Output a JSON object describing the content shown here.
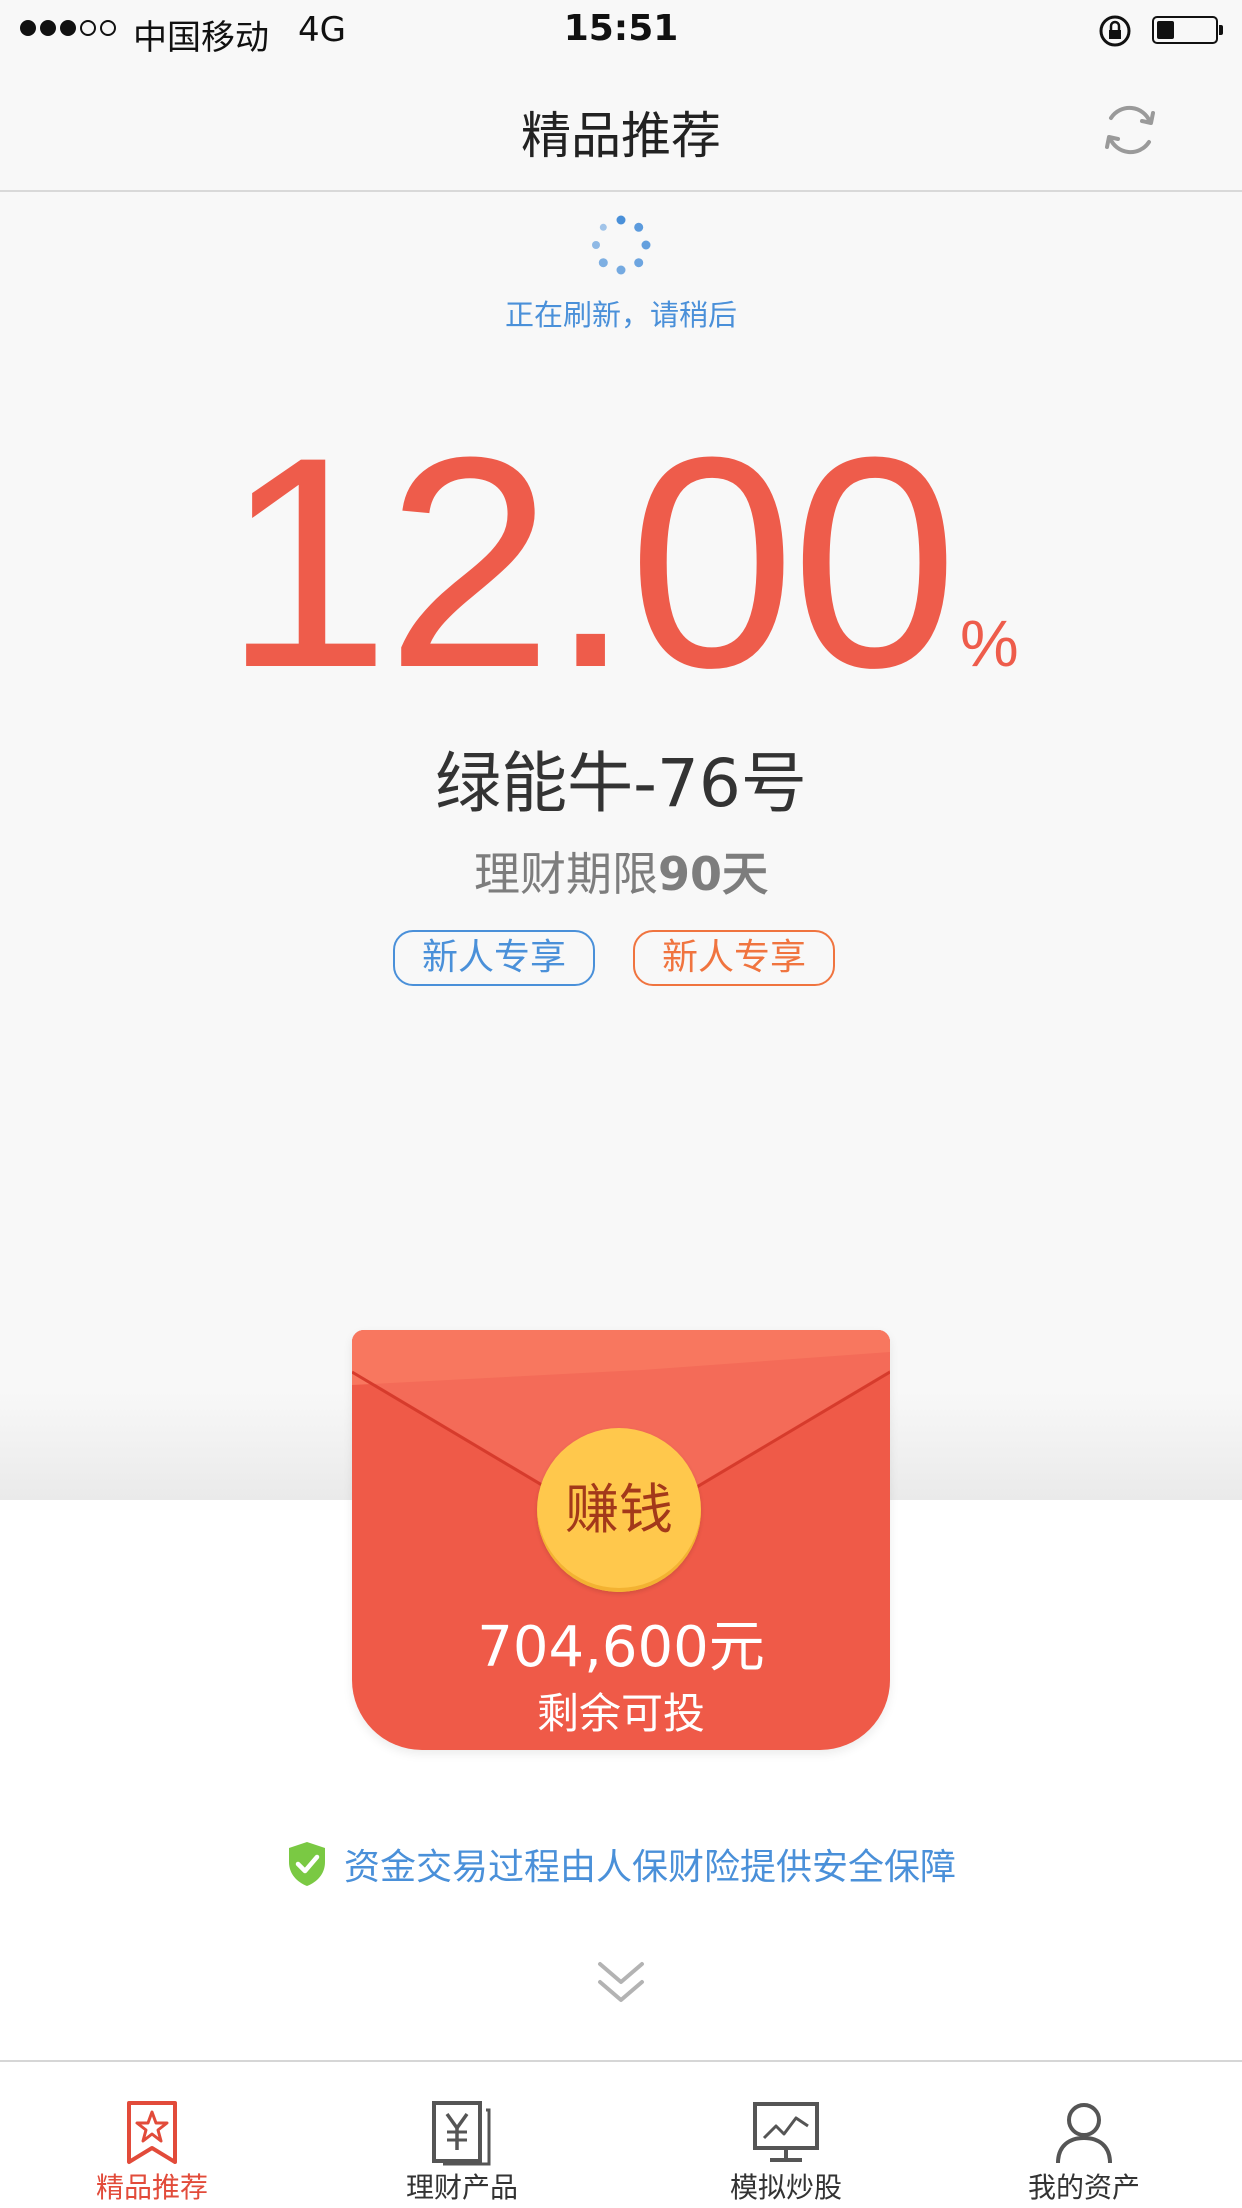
{
  "status_bar": {
    "carrier": "中国移动",
    "network": "4G",
    "time": "15:51",
    "signal_bars": 3,
    "signal_max": 5,
    "battery_level": 0.25
  },
  "nav": {
    "title": "精品推荐",
    "refresh_icon": "refresh-icon"
  },
  "loading": {
    "text": "正在刷新，请稍后"
  },
  "product": {
    "rate": "12.00",
    "rate_unit": "%",
    "name": "绿能牛-76号",
    "term_label": "理财期限",
    "term_value": "90天",
    "tags": [
      "新人专享",
      "新人专享"
    ]
  },
  "envelope": {
    "coin_text": "赚钱",
    "amount": "704,600元",
    "amount_label": "剩余可投"
  },
  "security": {
    "text": "资金交易过程由人保财险提供安全保障"
  },
  "tabs": [
    {
      "label": "精品推荐",
      "icon": "bookmark-star-icon",
      "active": true
    },
    {
      "label": "理财产品",
      "icon": "yuan-document-icon",
      "active": false
    },
    {
      "label": "模拟炒股",
      "icon": "chart-monitor-icon",
      "active": false
    },
    {
      "label": "我的资产",
      "icon": "user-icon",
      "active": false
    }
  ],
  "colors": {
    "accent_red": "#ee5c4b",
    "link_blue": "#4a90d9",
    "tag_orange": "#f0743f",
    "coin_gold": "#ffc84c"
  }
}
